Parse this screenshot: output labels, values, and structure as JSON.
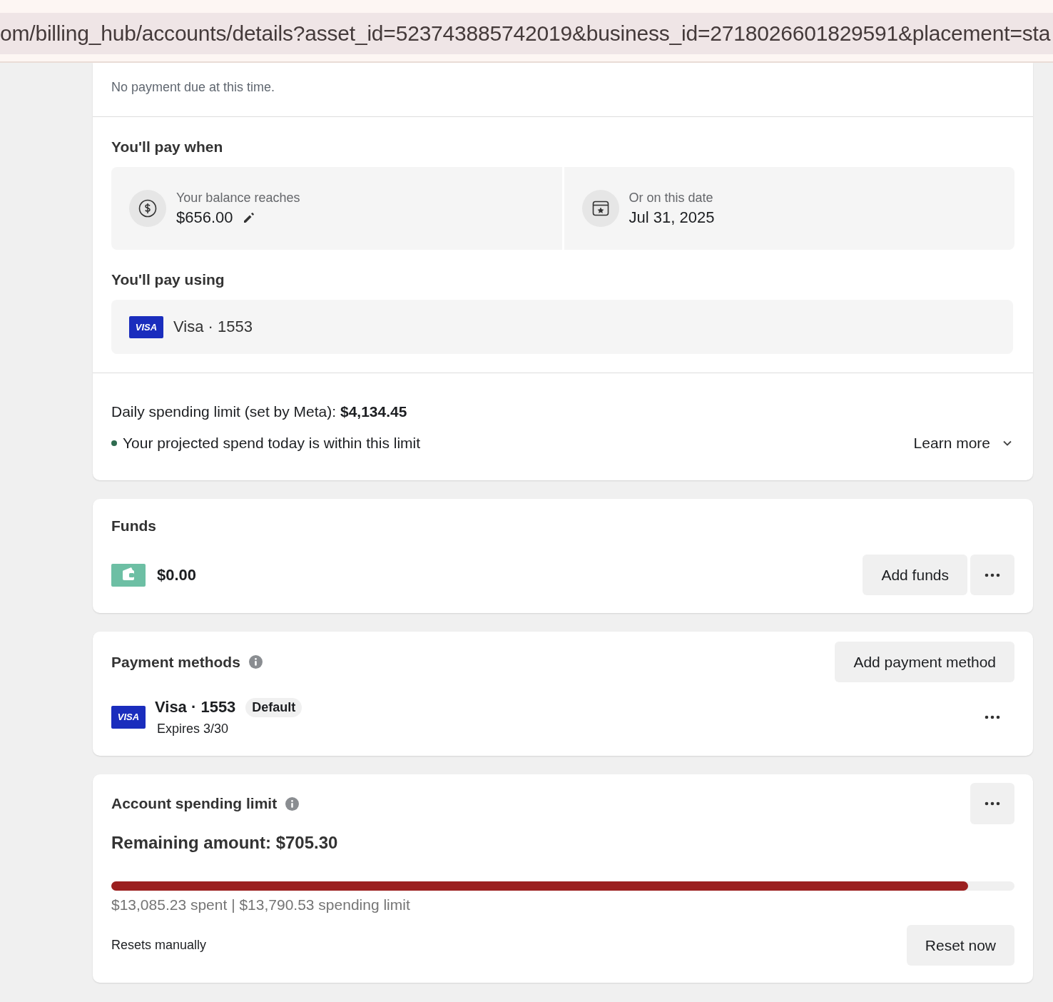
{
  "address_bar": {
    "url": "om/billing_hub/accounts/details?asset_id=523743885742019&business_id=2718026601829591&placement=sta"
  },
  "balance": {
    "note": "No payment due at this time."
  },
  "pay_when": {
    "title": "You'll pay when",
    "options": [
      {
        "kind": "threshold",
        "label": "Your balance reaches",
        "value": "$656.00"
      },
      {
        "kind": "date",
        "label": "Or on this date",
        "value": "Jul 31, 2025"
      }
    ]
  },
  "pay_using": {
    "title": "You'll pay using",
    "card_brand": "VISA",
    "card": "Visa · 1553"
  },
  "daily_limit": {
    "text": "Daily spending limit (set by Meta): **$4,134.45**",
    "status": {
      "text": "Your projected spend today is within this limit",
      "color": "#2e6b4f"
    },
    "link": "Learn more"
  },
  "funds": {
    "title": "Funds",
    "amount": "$0.00",
    "button": "Add funds"
  },
  "payment_methods": {
    "title": "Payment methods",
    "button": "Add payment method",
    "methods": [
      {
        "brand": "VISA",
        "name": "Visa · 1553",
        "badge": "Default",
        "expires": "Expires 3/30"
      }
    ]
  },
  "spending_limit": {
    "title": "Account spending limit",
    "remaining": "Remaining amount: $705.30",
    "level": 0.949,
    "summary": "$13,085.23 spent | $13,790.53 spending limit",
    "reset_note": "Resets manually",
    "button": "Reset now"
  }
}
